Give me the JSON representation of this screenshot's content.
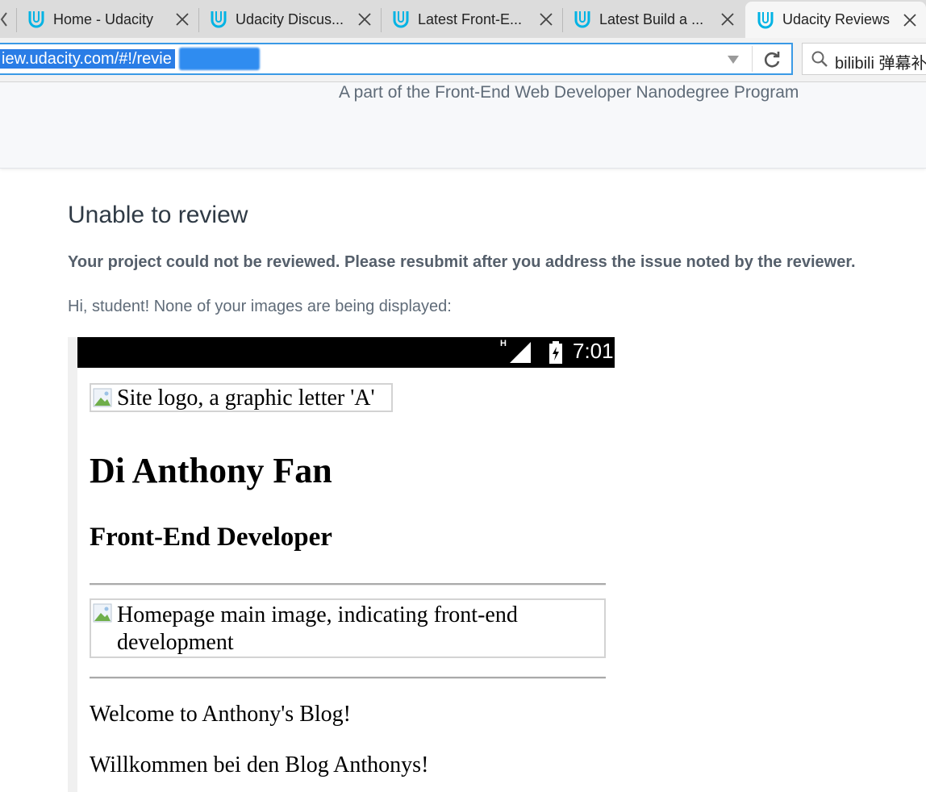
{
  "browser": {
    "tabs": [
      {
        "title": "Home - Udacity",
        "active": false
      },
      {
        "title": "Udacity Discus...",
        "active": false
      },
      {
        "title": "Latest Front-E...",
        "active": false
      },
      {
        "title": "Latest Build a ...",
        "active": false
      },
      {
        "title": "Udacity Reviews",
        "active": true
      }
    ],
    "url": "iew.udacity.com/#!/revie",
    "search_value": "bilibili 弹幕补",
    "accent_color": "#2a7de6",
    "logo_color": "#02b3e4"
  },
  "header": {
    "subtitle": "A part of the Front-End Web Developer Nanodegree Program"
  },
  "review": {
    "title": "Unable to review",
    "summary": "Your project could not be reviewed. Please resubmit after you address the issue noted by the reviewer.",
    "message": "Hi, student! None of your images are being displayed:"
  },
  "screenshot": {
    "status_bar": {
      "network": "H",
      "time": "7:01"
    },
    "logo_alt": "Site logo, a graphic letter 'A'",
    "heading": "Di Anthony Fan",
    "subheading": "Front-End Developer",
    "main_image_alt": "Homepage main image, indicating front-end development",
    "paragraph_1": "Welcome to Anthony's Blog!",
    "paragraph_2": "Willkommen bei den Blog Anthonys!"
  }
}
